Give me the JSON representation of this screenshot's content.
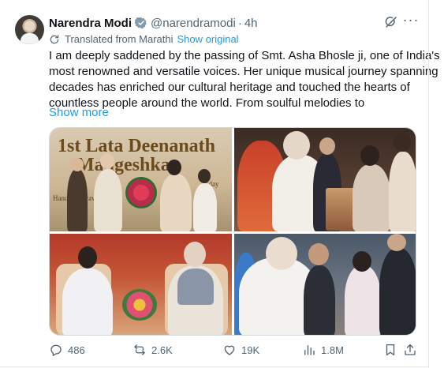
{
  "post": {
    "author": {
      "display_name": "Narendra Modi",
      "handle": "@narendramodi",
      "separator": "·",
      "time": "4h",
      "verified_badge_color": "#829aab",
      "avatar_icon": "profile-photo"
    },
    "translation": {
      "label": "Translated from Marathi",
      "show_original_label": "Show original",
      "icon": "translate-icon"
    },
    "body_lines": [
      "I am deeply saddened by the passing of Smt. Asha Bhosle ji, one of India's",
      "most renowned and versatile voices. Her unique musical journey spanning",
      "decades has enriched our cultural heritage and touched the hearts of",
      "countless people around the world. From soulful melodies to"
    ],
    "show_more_label": "Show more",
    "media": {
      "photo_count": 4,
      "photo1_banner": [
        "1st Lata Deenanath",
        "Mangeshkar"
      ],
      "photo1_banner_small": [
        "Hanumanthrav",
        "riday"
      ]
    },
    "actions": {
      "replies": "486",
      "reposts": "2.6K",
      "likes": "19K",
      "views": "1.8M"
    }
  },
  "colors": {
    "accent_link": "#1d9bf0",
    "muted_text": "#536471",
    "primary_text": "#0f1419",
    "border": "#cfd9de"
  }
}
